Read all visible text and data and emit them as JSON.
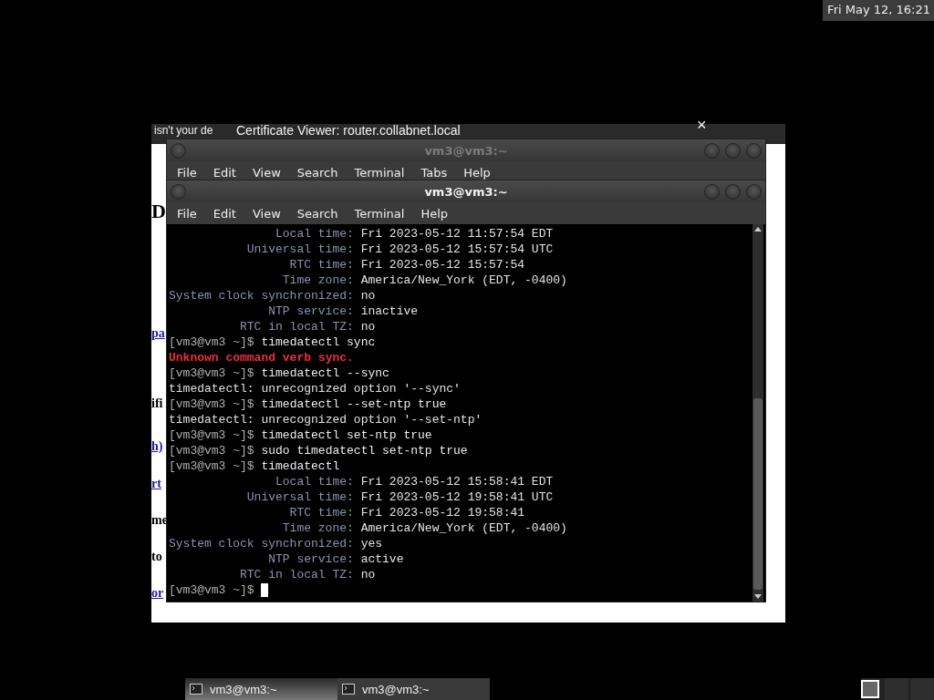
{
  "clock": "Fri May 12, 16:21",
  "browser": {
    "tab_fragment": "isn't your de",
    "dialog_title": "Certificate Viewer: router.collabnet.local",
    "close": "×",
    "page_fragments": [
      {
        "text": "D",
        "kind": "heading"
      },
      {
        "text": "pa",
        "kind": "link"
      },
      {
        "text": "ifi",
        "kind": "bold"
      },
      {
        "text": "h)",
        "kind": "link"
      },
      {
        "text": "rt",
        "kind": "link"
      },
      {
        "text": "me",
        "kind": "bold"
      },
      {
        "text": "to",
        "kind": "bold"
      },
      {
        "text": "or",
        "kind": "link"
      }
    ]
  },
  "windows": [
    {
      "title": "vm3@vm3:~",
      "active": false,
      "menu": [
        "File",
        "Edit",
        "View",
        "Search",
        "Terminal",
        "Tabs",
        "Help"
      ]
    },
    {
      "title": "vm3@vm3:~",
      "active": true,
      "menu": [
        "File",
        "Edit",
        "View",
        "Search",
        "Terminal",
        "Help"
      ]
    }
  ],
  "terminal": {
    "lines": [
      {
        "kind": "field",
        "label": "Local time:",
        "value": "Fri 2023-05-12 11:57:54 EDT"
      },
      {
        "kind": "field",
        "label": "Universal time:",
        "value": "Fri 2023-05-12 15:57:54 UTC"
      },
      {
        "kind": "field",
        "label": "RTC time:",
        "value": "Fri 2023-05-12 15:57:54"
      },
      {
        "kind": "field",
        "label": "Time zone:",
        "value": "America/New_York (EDT, -0400)"
      },
      {
        "kind": "field",
        "label": "System clock synchronized:",
        "value": "no"
      },
      {
        "kind": "field",
        "label": "NTP service:",
        "value": "inactive"
      },
      {
        "kind": "field",
        "label": "RTC in local TZ:",
        "value": "no"
      },
      {
        "kind": "command",
        "prompt": "[vm3@vm3 ~]$",
        "value": "timedatectl sync"
      },
      {
        "kind": "error",
        "value": "Unknown command verb sync."
      },
      {
        "kind": "command",
        "prompt": "[vm3@vm3 ~]$",
        "value": "timedatectl --sync"
      },
      {
        "kind": "output",
        "value": "timedatectl: unrecognized option '--sync'"
      },
      {
        "kind": "command",
        "prompt": "[vm3@vm3 ~]$",
        "value": "timedatectl --set-ntp true"
      },
      {
        "kind": "output",
        "value": "timedatectl: unrecognized option '--set-ntp'"
      },
      {
        "kind": "command",
        "prompt": "[vm3@vm3 ~]$",
        "value": "timedatectl set-ntp true"
      },
      {
        "kind": "command",
        "prompt": "[vm3@vm3 ~]$",
        "value": "sudo timedatectl set-ntp true"
      },
      {
        "kind": "command",
        "prompt": "[vm3@vm3 ~]$",
        "value": "timedatectl"
      },
      {
        "kind": "field",
        "label": "Local time:",
        "value": "Fri 2023-05-12 15:58:41 EDT"
      },
      {
        "kind": "field",
        "label": "Universal time:",
        "value": "Fri 2023-05-12 19:58:41 UTC"
      },
      {
        "kind": "field",
        "label": "RTC time:",
        "value": "Fri 2023-05-12 19:58:41"
      },
      {
        "kind": "field",
        "label": "Time zone:",
        "value": "America/New_York (EDT, -0400)"
      },
      {
        "kind": "field",
        "label": "System clock synchronized:",
        "value": "yes"
      },
      {
        "kind": "field",
        "label": "NTP service:",
        "value": "active"
      },
      {
        "kind": "field",
        "label": "RTC in local TZ:",
        "value": "no"
      },
      {
        "kind": "prompt",
        "prompt": "[vm3@vm3 ~]$"
      }
    ]
  },
  "taskbar": {
    "tasks": [
      {
        "label": "vm3@vm3:~",
        "selected": true
      },
      {
        "label": "vm3@vm3:~",
        "selected": false
      }
    ]
  }
}
